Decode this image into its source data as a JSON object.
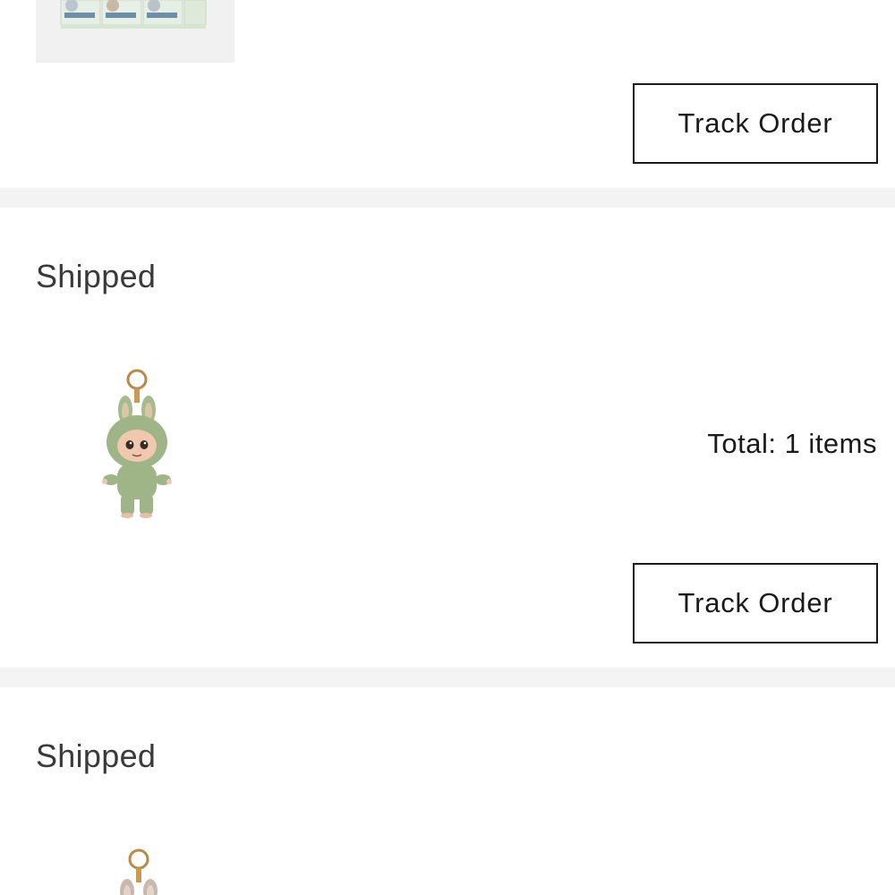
{
  "orders": [
    {
      "product_icon": "blind-box-set-image",
      "track_label": "Track Order"
    },
    {
      "status": "Shipped",
      "product_icon": "green-bunny-keychain-image",
      "total": "Total: 1 items",
      "track_label": "Track Order"
    },
    {
      "status": "Shipped",
      "product_icon": "bunny-keychain-image"
    }
  ],
  "colors": {
    "background": "#ffffff",
    "divider": "#f3f3f3",
    "text": "#1a1a1a",
    "status_text": "#3a3a3a",
    "button_border": "#1a1a1a"
  }
}
